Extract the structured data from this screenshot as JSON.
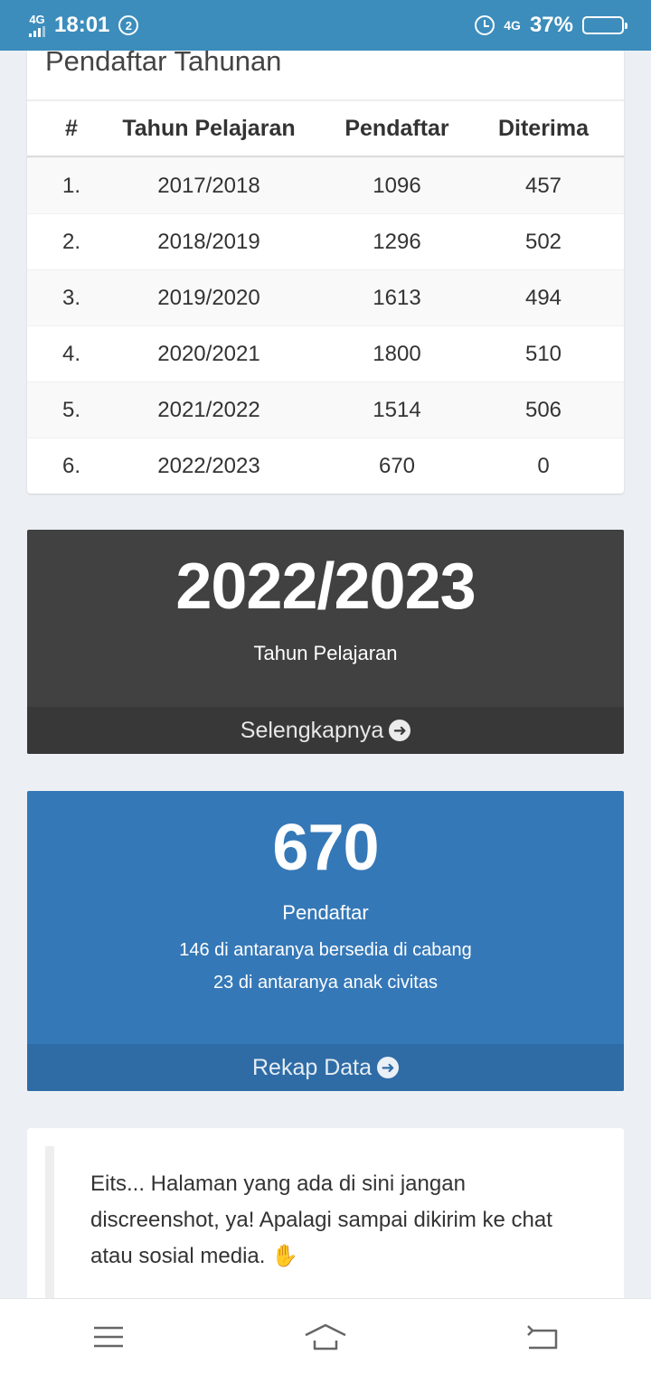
{
  "status_bar": {
    "network": "4G",
    "time": "18:01",
    "notification_count": "2",
    "network_right": "4G",
    "battery": "37%",
    "battery_level": 0.37
  },
  "table_card": {
    "title": "Pendaftar Tahunan",
    "headers": [
      "#",
      "Tahun Pelajaran",
      "Pendaftar",
      "Diterima"
    ],
    "rows": [
      [
        "1.",
        "2017/2018",
        "1096",
        "457"
      ],
      [
        "2.",
        "2018/2019",
        "1296",
        "502"
      ],
      [
        "3.",
        "2019/2020",
        "1613",
        "494"
      ],
      [
        "4.",
        "2020/2021",
        "1800",
        "510"
      ],
      [
        "5.",
        "2021/2022",
        "1514",
        "506"
      ],
      [
        "6.",
        "2022/2023",
        "670",
        "0"
      ]
    ]
  },
  "year_box": {
    "value": "2022/2023",
    "label": "Tahun Pelajaran",
    "footer_link": "Selengkapnya",
    "color": "#414141"
  },
  "registrant_box": {
    "value": "670",
    "label": "Pendaftar",
    "line1": "146 di antaranya bersedia di cabang",
    "line2": "23 di antaranya anak civitas",
    "footer_link": "Rekap Data",
    "color": "#3578b7"
  },
  "notice": {
    "text": "Eits... Halaman yang ada di sini jangan discreenshot, ya! Apalagi sampai dikirim ke chat atau sosial media.",
    "emoji": "✋"
  },
  "icons": {
    "menu": "menu-icon",
    "home": "home-icon",
    "back": "back-icon"
  }
}
